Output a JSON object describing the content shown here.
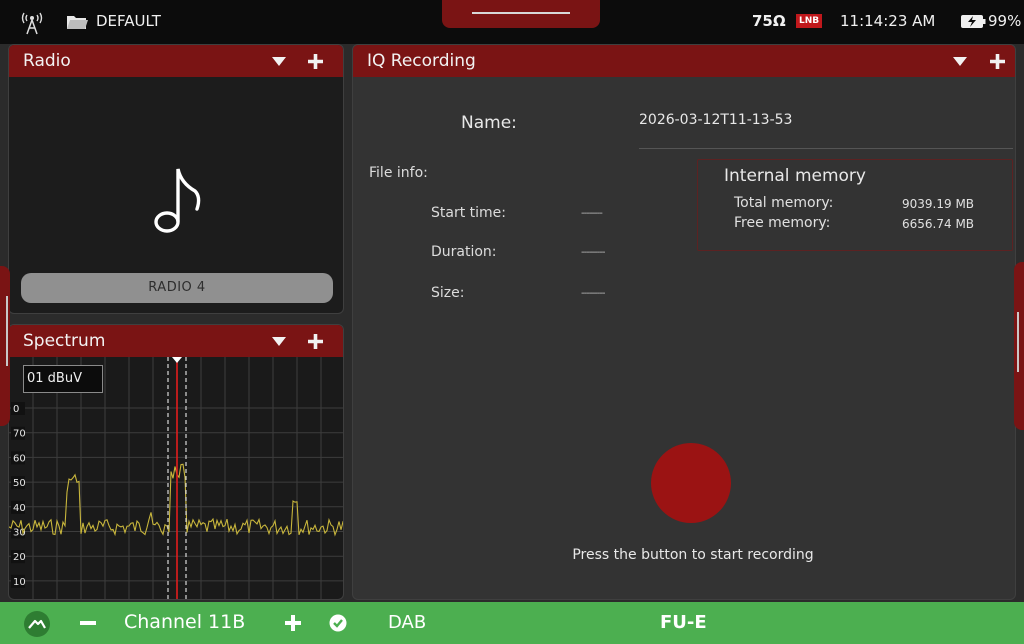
{
  "status_bar": {
    "antenna_icon": "antenna-icon",
    "folder_icon": "folder-icon",
    "profile": "DEFAULT",
    "impedance": "75Ω",
    "lnb_badge": "LNB",
    "time": "11:14:23 AM",
    "battery_icon": "battery-charging-icon",
    "battery": "99%"
  },
  "radio_panel": {
    "title": "Radio",
    "icon": "music-note-icon",
    "station": "RADIO 4"
  },
  "spectrum_panel": {
    "title": "Spectrum",
    "ref_level": "01 dBuV",
    "y_ticks": [
      "0",
      "70",
      "60",
      "50",
      "40",
      "30",
      "20",
      "10"
    ],
    "trace_color": "#c8b63c",
    "marker_color": "#e21d1d"
  },
  "iq_panel": {
    "title": "IQ Recording",
    "name_label": "Name:",
    "name_value": "2026-03-12T11-13-53",
    "file_info_label": "File info:",
    "rows": [
      {
        "label": "Start time:",
        "value": "--------"
      },
      {
        "label": "Duration:",
        "value": "---------"
      },
      {
        "label": "Size:",
        "value": "---------"
      }
    ],
    "memory": {
      "title": "Internal memory",
      "total_label": "Total memory:",
      "total_value": "9039.19 MB",
      "free_label": "Free memory:",
      "free_value": "6656.74 MB"
    },
    "record_color": "#9b1313",
    "hint": "Press the button to start recording"
  },
  "bottom_bar": {
    "home_icon": "signal-home-icon",
    "channel": "Channel 11B",
    "standard": "DAB",
    "service": "FU-E",
    "color": "#4caf50"
  }
}
